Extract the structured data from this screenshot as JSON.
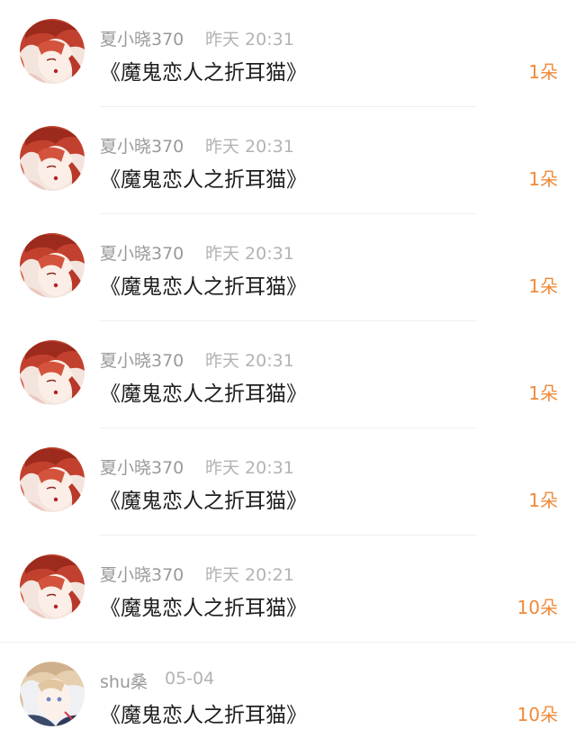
{
  "gift_list": {
    "items": [
      {
        "username": "夏小晓370",
        "time": "昨天 20:31",
        "title": "《魔鬼恋人之折耳猫》",
        "count": "1朵",
        "avatar": "red-haired-anime-avatar"
      },
      {
        "username": "夏小晓370",
        "time": "昨天 20:31",
        "title": "《魔鬼恋人之折耳猫》",
        "count": "1朵",
        "avatar": "red-haired-anime-avatar"
      },
      {
        "username": "夏小晓370",
        "time": "昨天 20:31",
        "title": "《魔鬼恋人之折耳猫》",
        "count": "1朵",
        "avatar": "red-haired-anime-avatar"
      },
      {
        "username": "夏小晓370",
        "time": "昨天 20:31",
        "title": "《魔鬼恋人之折耳猫》",
        "count": "1朵",
        "avatar": "red-haired-anime-avatar"
      },
      {
        "username": "夏小晓370",
        "time": "昨天 20:31",
        "title": "《魔鬼恋人之折耳猫》",
        "count": "1朵",
        "avatar": "red-haired-anime-avatar"
      },
      {
        "username": "夏小晓370",
        "time": "昨天 20:21",
        "title": "《魔鬼恋人之折耳猫》",
        "count": "10朵",
        "avatar": "red-haired-anime-avatar"
      },
      {
        "username": "shu桑",
        "time": "05-04",
        "title": "《魔鬼恋人之折耳猫》",
        "count": "10朵",
        "avatar": "light-haired-anime-avatar"
      }
    ]
  },
  "colors": {
    "username": "#9a9a9a",
    "timestamp": "#b3b3b3",
    "title": "#1e1e1e",
    "count_accent": "#ef8a3a",
    "divider": "#efefef"
  }
}
